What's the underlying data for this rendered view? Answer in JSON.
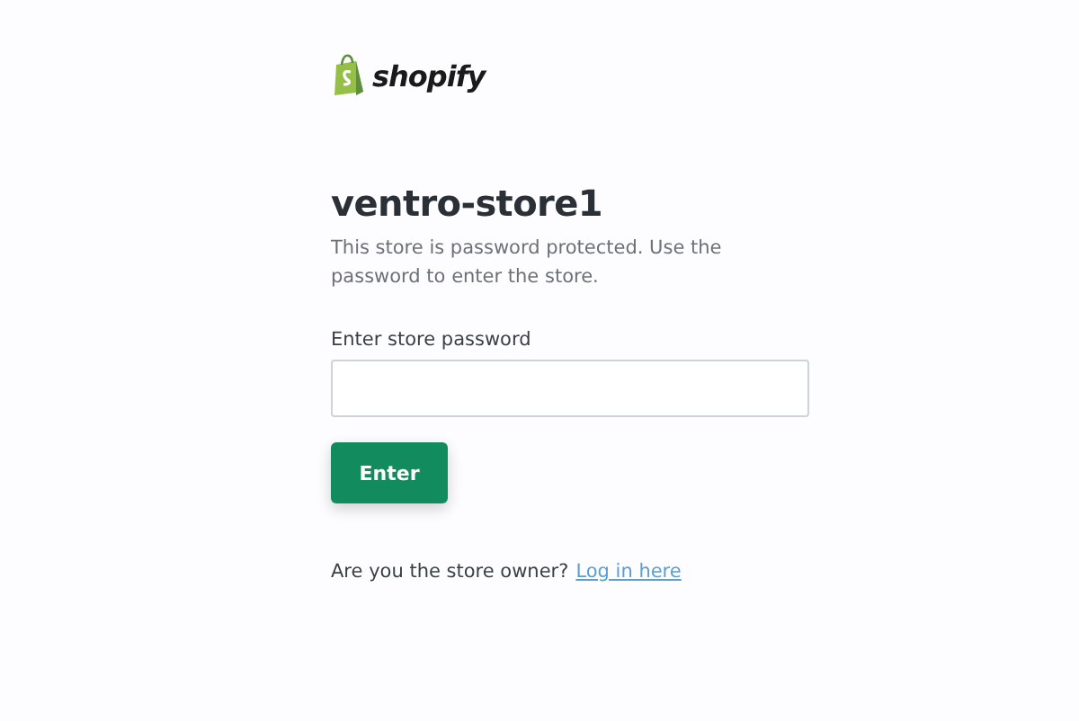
{
  "logo": {
    "text": "shopify"
  },
  "title": "ventro-store1",
  "description": "This store is password protected. Use the password to enter the store.",
  "password_field": {
    "label": "Enter store password"
  },
  "buttons": [
    "Enter"
  ],
  "footer": {
    "text": "Are you the store owner?",
    "link": "Log in here"
  }
}
